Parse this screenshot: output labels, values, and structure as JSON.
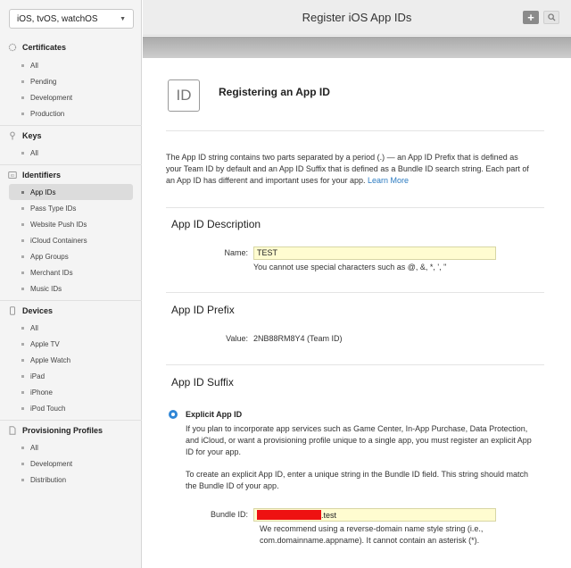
{
  "platform": {
    "selected": "iOS, tvOS, watchOS"
  },
  "sidebar": {
    "sections": [
      {
        "label": "Certificates",
        "icon": "certificate-icon",
        "items": [
          "All",
          "Pending",
          "Development",
          "Production"
        ]
      },
      {
        "label": "Keys",
        "icon": "key-icon",
        "items": [
          "All"
        ]
      },
      {
        "label": "Identifiers",
        "icon": "id-icon",
        "items": [
          "App IDs",
          "Pass Type IDs",
          "Website Push IDs",
          "iCloud Containers",
          "App Groups",
          "Merchant IDs",
          "Music IDs"
        ]
      },
      {
        "label": "Devices",
        "icon": "device-icon",
        "items": [
          "All",
          "Apple TV",
          "Apple Watch",
          "iPad",
          "iPhone",
          "iPod Touch"
        ]
      },
      {
        "label": "Provisioning Profiles",
        "icon": "document-icon",
        "items": [
          "All",
          "Development",
          "Distribution"
        ]
      }
    ],
    "active": "App IDs"
  },
  "header": {
    "title": "Register iOS App IDs",
    "add_label": "+"
  },
  "main": {
    "id_badge": "ID",
    "heading": "Registering an App ID",
    "intro": "The App ID string contains two parts separated by a period (.) — an App ID Prefix that is defined as your Team ID by default and an App ID Suffix that is defined as a Bundle ID search string. Each part of an App ID has different and important uses for your app.",
    "learn_more": "Learn More",
    "description": {
      "title": "App ID Description",
      "name_label": "Name:",
      "name_value": "TEST",
      "name_hint": "You cannot use special characters such as @, &, *, ', \""
    },
    "prefix": {
      "title": "App ID Prefix",
      "value_label": "Value:",
      "value": "2NB88RM8Y4 (Team ID)"
    },
    "suffix": {
      "title": "App ID Suffix",
      "explicit_label": "Explicit App ID",
      "explicit_desc": "If you plan to incorporate app services such as Game Center, In-App Purchase, Data Protection, and iCloud, or want a provisioning profile unique to a single app, you must register an explicit App ID for your app.",
      "explicit_desc2": "To create an explicit App ID, enter a unique string in the Bundle ID field. This string should match the Bundle ID of your app.",
      "bundle_label": "Bundle ID:",
      "bundle_value_suffix": ".test",
      "bundle_hint": "We recommend using a reverse-domain name style string (i.e., com.domainname.appname). It cannot contain an asterisk (*)."
    }
  },
  "colors": {
    "accent": "#2f86d6",
    "link": "#2a7ac0",
    "input_bg": "#fffcd0",
    "redaction": "#ee1111"
  }
}
